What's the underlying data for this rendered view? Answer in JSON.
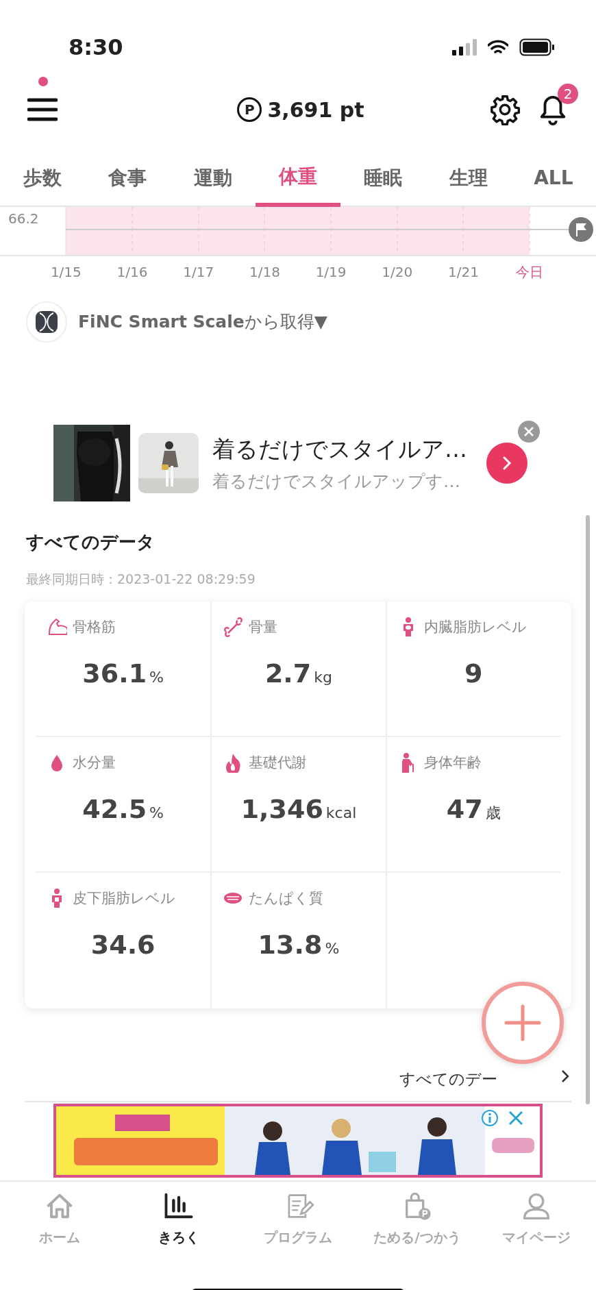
{
  "status_bar": {
    "time": "8:30"
  },
  "header": {
    "points": "3,691 pt",
    "points_icon": "P",
    "menu_dot": true,
    "notifications": "2"
  },
  "tabs": [
    {
      "label": "歩数",
      "selected": false
    },
    {
      "label": "食事",
      "selected": false
    },
    {
      "label": "運動",
      "selected": false
    },
    {
      "label": "体重",
      "selected": true
    },
    {
      "label": "睡眠",
      "selected": false
    },
    {
      "label": "生理",
      "selected": false
    },
    {
      "label": "ALL",
      "selected": false
    }
  ],
  "chart": {
    "y_label": "66.2",
    "dates": [
      {
        "label": "1/15",
        "today": false
      },
      {
        "label": "1/16",
        "today": false
      },
      {
        "label": "1/17",
        "today": false
      },
      {
        "label": "1/18",
        "today": false
      },
      {
        "label": "1/19",
        "today": false
      },
      {
        "label": "1/20",
        "today": false
      },
      {
        "label": "1/21",
        "today": false
      },
      {
        "label": "今日",
        "today": true
      }
    ]
  },
  "source": {
    "device": "FiNC Smart Scale",
    "suffix": "から取得▼"
  },
  "ad": {
    "title": "着るだけでスタイルア…",
    "subtitle": "着るだけでスタイルアップす…"
  },
  "all_data": {
    "title": "すべてのデータ",
    "synced": "最終同期日時：2023-01-22 08:29:59",
    "metrics": [
      {
        "kind": "muscle",
        "label": "骨格筋",
        "value": "36.1",
        "unit": "%"
      },
      {
        "kind": "bone",
        "label": "骨量",
        "value": "2.7",
        "unit": "kg"
      },
      {
        "kind": "visceral",
        "label": "内臓脂肪レベル",
        "value": "9"
      },
      {
        "kind": "water",
        "label": "水分量",
        "value": "42.5",
        "unit": "%"
      },
      {
        "kind": "metabolism",
        "label": "基礎代謝",
        "value": "1,346",
        "unit": "kcal"
      },
      {
        "kind": "age",
        "label": "身体年齢",
        "value": "47",
        "unit": "歳"
      },
      {
        "kind": "subcutaneous",
        "label": "皮下脂肪レベル",
        "value": "34.6"
      },
      {
        "kind": "protein",
        "label": "たんぱく質",
        "value": "13.8",
        "unit": "%"
      }
    ],
    "more_link": "すべてのデー"
  },
  "bottom_nav": [
    {
      "kind": "home",
      "label": "ホーム",
      "selected": false
    },
    {
      "kind": "record",
      "label": "きろく",
      "selected": true
    },
    {
      "kind": "program",
      "label": "プログラム",
      "selected": false
    },
    {
      "kind": "points",
      "label": "ためる/つかう",
      "selected": false
    },
    {
      "kind": "mypage",
      "label": "マイページ",
      "selected": false
    }
  ]
}
